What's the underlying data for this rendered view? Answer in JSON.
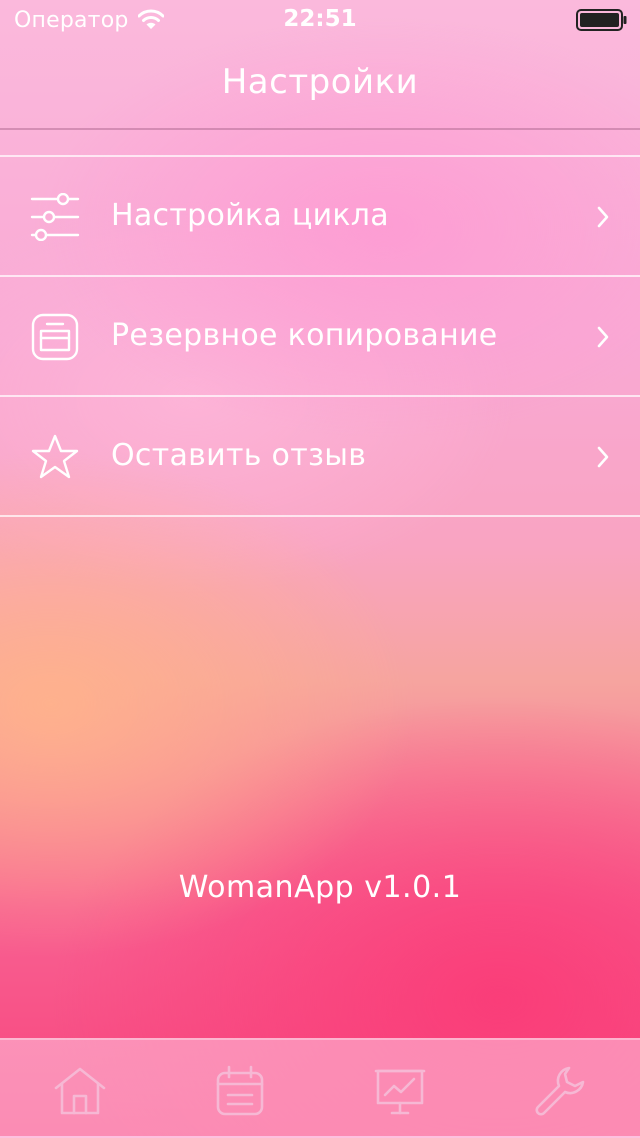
{
  "status_bar": {
    "carrier": "Оператор",
    "time": "22:51",
    "wifi_icon": "wifi-icon",
    "battery_icon": "battery-icon"
  },
  "nav": {
    "title": "Настройки"
  },
  "settings": {
    "items": [
      {
        "label": "Настройка цикла",
        "icon": "sliders-icon"
      },
      {
        "label": "Резервное копирование",
        "icon": "backup-icon"
      },
      {
        "label": "Оставить отзыв",
        "icon": "star-icon"
      }
    ]
  },
  "version": "WomanApp v1.0.1",
  "tab_bar": {
    "tabs": [
      {
        "icon": "home-icon"
      },
      {
        "icon": "calendar-icon"
      },
      {
        "icon": "chart-icon"
      },
      {
        "icon": "wrench-icon"
      }
    ]
  },
  "colors": {
    "text": "#ffffff",
    "background_top": "#fbb9dc",
    "background_bottom": "#f7437c",
    "tab_icon": "#f6b8d4"
  }
}
